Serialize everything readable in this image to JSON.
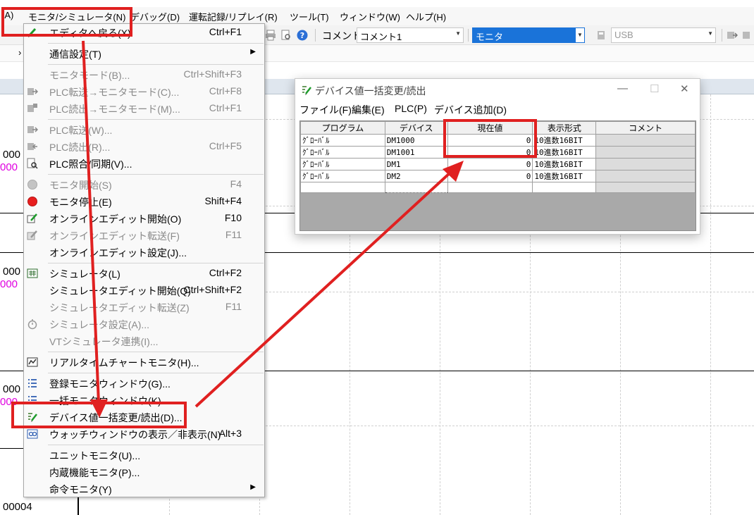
{
  "menubar": {
    "items": [
      {
        "label": "(A)"
      },
      {
        "label": "モニタ/シミュレータ(N)"
      },
      {
        "label": "デバッグ(D)"
      },
      {
        "label": "運転記録/リプレイ(R)"
      },
      {
        "label": "ツール(T)"
      },
      {
        "label": "ウィンドウ(W)"
      },
      {
        "label": "ヘルプ(H)"
      }
    ]
  },
  "toolbar": {
    "comment_label": "コメント",
    "comment_value": "コメント1",
    "mode_value": "モニタ",
    "connection_value": "USB"
  },
  "ladder": {
    "rung_numbers": [
      "000",
      "000",
      "000",
      "00004"
    ],
    "rung_pink": [
      "000",
      "000",
      "000"
    ]
  },
  "dropdown": {
    "items": [
      {
        "label": "エディタへ戻る(X)",
        "shortcut": "Ctrl+F1",
        "icon": "pencil-icon"
      },
      {
        "label": "通信設定(T)",
        "shortcut": "",
        "icon": ""
      },
      {
        "label": "モニタモード(B)...",
        "shortcut": "Ctrl+Shift+F3",
        "icon": ""
      },
      {
        "label": "PLC転送→モニタモード(C)...",
        "shortcut": "Ctrl+F8",
        "icon": "transfer-icon"
      },
      {
        "label": "PLC読出→モニタモード(M)...",
        "shortcut": "Ctrl+F1",
        "icon": "read-icon"
      },
      {
        "label": "PLC転送(W)...",
        "shortcut": "",
        "icon": "transfer-icon"
      },
      {
        "label": "PLC読出(R)...",
        "shortcut": "Ctrl+F5",
        "icon": "read-icon"
      },
      {
        "label": "PLC照合/同期(V)...",
        "shortcut": "",
        "icon": "verify-icon"
      },
      {
        "label": "モニタ開始(S)",
        "shortcut": "F4",
        "icon": "gray-circle-icon"
      },
      {
        "label": "モニタ停止(E)",
        "shortcut": "Shift+F4",
        "icon": "red-circle-icon"
      },
      {
        "label": "オンラインエディット開始(O)",
        "shortcut": "F10",
        "icon": "online-edit-icon"
      },
      {
        "label": "オンラインエディット転送(F)",
        "shortcut": "F11",
        "icon": "online-transfer-icon"
      },
      {
        "label": "オンラインエディット設定(J)...",
        "shortcut": "",
        "icon": ""
      },
      {
        "label": "シミュレータ(L)",
        "shortcut": "Ctrl+F2",
        "icon": "simulator-icon"
      },
      {
        "label": "シミュレータエディット開始(Q)",
        "shortcut": "Ctrl+Shift+F2",
        "icon": ""
      },
      {
        "label": "シミュレータエディット転送(Z)",
        "shortcut": "F11",
        "icon": ""
      },
      {
        "label": "シミュレータ設定(A)...",
        "shortcut": "",
        "icon": "stopwatch-icon"
      },
      {
        "label": "VTシミュレータ連携(I)...",
        "shortcut": "",
        "icon": ""
      },
      {
        "label": "リアルタイムチャートモニタ(H)...",
        "shortcut": "",
        "icon": "chart-icon"
      },
      {
        "label": "登録モニタウィンドウ(G)...",
        "shortcut": "",
        "icon": "list-icon"
      },
      {
        "label": "一括モニタウィンドウ(K)...",
        "shortcut": "",
        "icon": "list-icon"
      },
      {
        "label": "デバイス値一括変更/読出(D)...",
        "shortcut": "",
        "icon": "device-edit-icon"
      },
      {
        "label": "ウォッチウィンドウの表示／非表示(N)",
        "shortcut": "Alt+3",
        "icon": "watch-icon"
      },
      {
        "label": "ユニットモニタ(U)...",
        "shortcut": "",
        "icon": ""
      },
      {
        "label": "内蔵機能モニタ(P)...",
        "shortcut": "",
        "icon": ""
      },
      {
        "label": "命令モニタ(Y)",
        "shortcut": "",
        "icon": ""
      }
    ]
  },
  "dialog": {
    "title": "デバイス値一括変更/読出",
    "menu": [
      "ファイル(F)",
      "編集(E)",
      "PLC(P)",
      "デバイス追加(D)"
    ],
    "columns": [
      "プログラム",
      "デバイス",
      "現在値",
      "表示形式",
      "コメント"
    ],
    "rows": [
      {
        "program": "ｸﾞﾛｰﾊﾞﾙ",
        "device": "DM1000",
        "value": "0",
        "format": "10進数16BIT",
        "comment": ""
      },
      {
        "program": "ｸﾞﾛｰﾊﾞﾙ",
        "device": "DM1001",
        "value": "0",
        "format": "10進数16BIT",
        "comment": ""
      },
      {
        "program": "ｸﾞﾛｰﾊﾞﾙ",
        "device": "DM1",
        "value": "0",
        "format": "10進数16BIT",
        "comment": ""
      },
      {
        "program": "ｸﾞﾛｰﾊﾞﾙ",
        "device": "DM2",
        "value": "0",
        "format": "10進数16BIT",
        "comment": ""
      }
    ]
  },
  "colors": {
    "annotation_red": "#e02020",
    "mode_blue": "#1a73d9",
    "menu_bg": "#f9f9f9"
  }
}
